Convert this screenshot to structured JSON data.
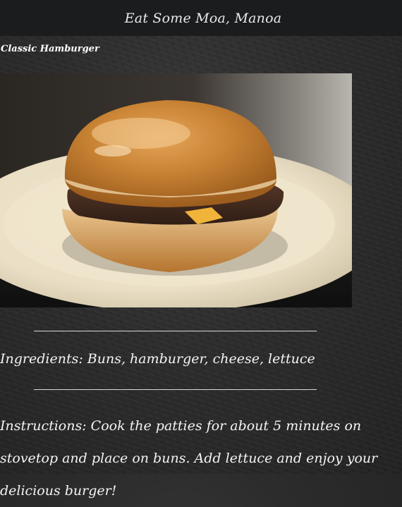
{
  "header": {
    "site_title": "Eat Some Moa, Manoa"
  },
  "recipe": {
    "title": "Classic Hamburger",
    "image": {
      "description_icon": "hamburger-photo"
    },
    "ingredients": "Ingredients: Buns, hamburger, cheese, lettuce",
    "instructions": "Instructions: Cook the patties for about 5 minutes on stovetop and place on buns. Add lettuce and enjoy your delicious burger!"
  },
  "colors": {
    "header_bg": "#1b1c1e",
    "page_bg": "#2c2c2c",
    "text": "#f4f4f4",
    "divider": "#d8d8d8"
  }
}
